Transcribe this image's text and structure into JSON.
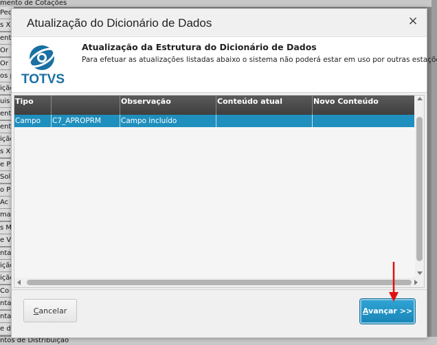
{
  "background": {
    "top_text": "mento de Cotações",
    "bottom_text": "ntos de Distribuição",
    "rows": [
      "Pedi",
      "s X",
      "ento",
      "Or",
      "Or",
      "os p",
      "ição",
      "uis",
      "ento",
      "ento",
      "ição",
      "s X",
      "e P",
      "Soli",
      "o P",
      "Ac",
      "maç",
      "s M",
      "e Ve",
      "nta",
      "ição",
      "ição",
      "Co",
      "nta",
      "nta",
      "e di"
    ]
  },
  "dialog": {
    "title": "Atualização do Dicionário de Dados",
    "close_glyph": "×",
    "header": {
      "logo_text": "TOTVS",
      "title": "Atualização da Estrutura do Dicionário de Dados",
      "subtitle": "Para efetuar as atualizações listadas abaixo o sistema não poderá estar em uso por outras estações"
    },
    "grid": {
      "columns": [
        "Tipo",
        "",
        "Observação",
        "Conteúdo atual",
        "Novo Conteúdo"
      ],
      "rows": [
        [
          "Campo",
          "C7_APROPRM",
          "Campo incluído",
          "",
          ""
        ]
      ]
    },
    "buttons": {
      "cancel": "Cancelar",
      "next": "Avançar >>"
    }
  },
  "colors": {
    "accent": "#1f8fbd",
    "header_bg": "#4a4a4a",
    "annotation_arrow": "#e01010"
  }
}
